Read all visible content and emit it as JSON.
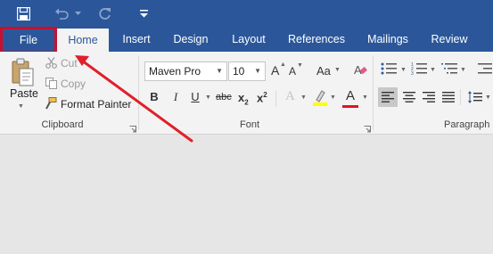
{
  "tabs": [
    {
      "label": "File"
    },
    {
      "label": "Home"
    },
    {
      "label": "Insert"
    },
    {
      "label": "Design"
    },
    {
      "label": "Layout"
    },
    {
      "label": "References"
    },
    {
      "label": "Mailings"
    },
    {
      "label": "Review"
    }
  ],
  "clipboard": {
    "paste_label": "Paste",
    "cut_label": "Cut",
    "copy_label": "Copy",
    "format_painter_label": "Format Painter",
    "group_label": "Clipboard"
  },
  "font": {
    "font_name": "Maven Pro",
    "font_size": "10",
    "grow_label": "A",
    "shrink_label": "A",
    "case_label": "Aa",
    "bold": "B",
    "italic": "I",
    "underline": "U",
    "strike": "abc",
    "subscript": "x",
    "superscript": "x",
    "sub_index": "2",
    "sup_index": "2",
    "effects": "A",
    "font_color": "A",
    "highlight_color_hex": "#ffff00",
    "font_color_hex": "#e81123",
    "group_label": "Font"
  },
  "paragraph": {
    "group_label": "Paragraph"
  },
  "colors": {
    "brand": "#2b579a",
    "ribbon": "#f3f3f3",
    "annotation": "#e0202b"
  }
}
